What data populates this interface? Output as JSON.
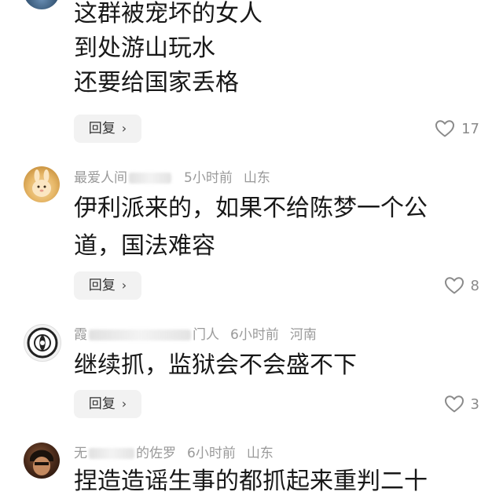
{
  "comments": [
    {
      "author": "",
      "time": "",
      "location": "",
      "text_lines": [
        "这群被宠坏的女人",
        "到处游山玩水",
        "还要给国家丢格"
      ],
      "reply_label": "回复",
      "likes": "17"
    },
    {
      "author": "最爱人间",
      "time": "5小时前",
      "location": "山东",
      "text_lines": [
        "伊利派来的，如果不给陈梦一个公",
        "道，国法难容"
      ],
      "reply_label": "回复",
      "likes": "8"
    },
    {
      "author": "霞",
      "author_suffix": "门人",
      "time": "6小时前",
      "location": "河南",
      "text_lines": [
        "继续抓，监狱会不会盛不下"
      ],
      "reply_label": "回复",
      "likes": "3"
    },
    {
      "author": "无",
      "author_suffix": "的佐罗",
      "time": "6小时前",
      "location": "山东",
      "text_lines": [
        "捏造造谣生事的都抓起来重判二十"
      ],
      "reply_label": "",
      "likes": ""
    }
  ],
  "icons": {
    "like": "heart-outline-icon",
    "reply_chevron": "chevron-right-icon"
  },
  "colors": {
    "text": "#181818",
    "meta": "#9a9a9a",
    "reply_bg": "#f2f2f2",
    "like": "#8a8a8a"
  }
}
